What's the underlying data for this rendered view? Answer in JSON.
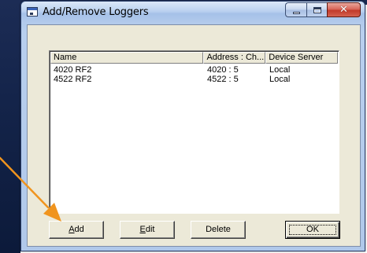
{
  "window": {
    "title": "Add/Remove Loggers"
  },
  "list": {
    "columns": [
      "Name",
      "Address : Ch...",
      "Device Server"
    ],
    "rows": [
      {
        "name": "4020 RF2",
        "address": "4020 : 5",
        "server": "Local"
      },
      {
        "name": "4522 RF2",
        "address": "4522 : 5",
        "server": "Local"
      }
    ]
  },
  "buttons": {
    "add_mnemonic": "A",
    "add_rest": "dd",
    "edit_mnemonic": "E",
    "edit_rest": "dit",
    "delete": "Delete",
    "ok": "OK"
  },
  "colors": {
    "annotation_arrow": "#f0941e",
    "close_button": "#c23a2a"
  },
  "icons": [
    "app-window-icon",
    "minimize-icon",
    "maximize-icon",
    "close-icon",
    "annotation-arrow"
  ]
}
